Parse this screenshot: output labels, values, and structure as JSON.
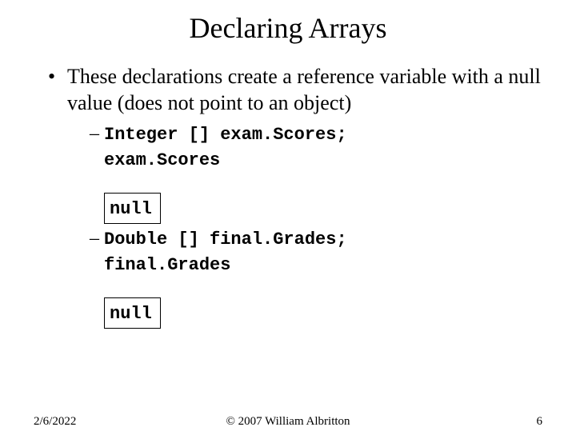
{
  "title": "Declaring Arrays",
  "bullet": {
    "text": "These declarations create a reference variable with a null value (does not point to an object)"
  },
  "sub1": {
    "decl": "Integer [] exam.Scores;",
    "var": "exam.Scores",
    "null": "null"
  },
  "sub2": {
    "decl": "Double [] final.Grades;",
    "var": "final.Grades",
    "null": "null"
  },
  "footer": {
    "date": "2/6/2022",
    "copyright": "© 2007 William Albritton",
    "page": "6"
  }
}
